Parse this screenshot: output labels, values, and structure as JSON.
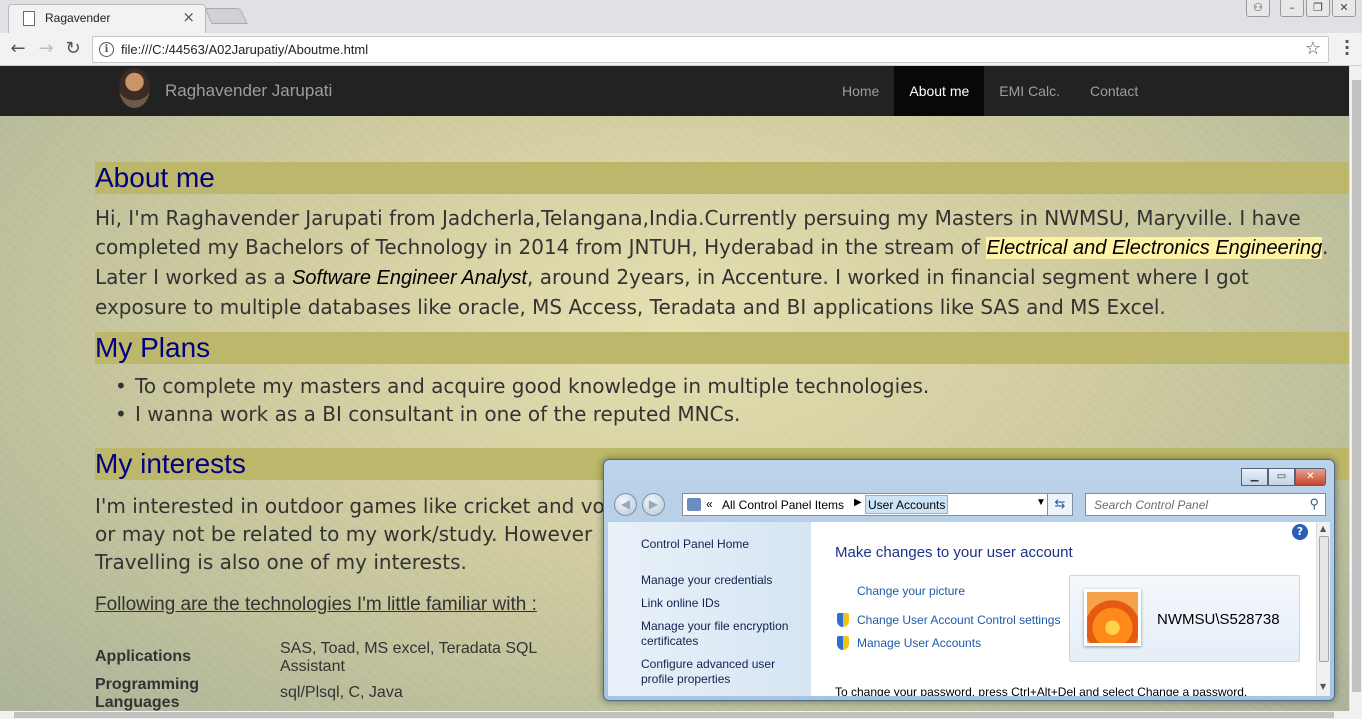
{
  "browser": {
    "tab_title": "Ragavender",
    "url": "file:///C:/44563/A02Jarupatiy/Aboutme.html"
  },
  "site": {
    "brand": "Raghavender Jarupati",
    "nav": [
      {
        "label": "Home",
        "active": false
      },
      {
        "label": "About me",
        "active": true
      },
      {
        "label": "EMI Calc.",
        "active": false
      },
      {
        "label": "Contact",
        "active": false
      }
    ]
  },
  "about": {
    "title": "About me",
    "p_part1": "Hi, I'm Raghavender Jarupati from Jadcherla,Telangana,India.Currently persuing my Masters in NWMSU, Maryville. I have completed my Bachelors of Technology in 2014 from JNTUH, Hyderabad in the stream of ",
    "p_em1": "Electrical and Electronics Engineering",
    "p_part2": ". Later I worked as a ",
    "p_em2": "Software Engineer Analyst",
    "p_part3": ", around 2years, in Accenture. I worked in financial segment where I got exposure to multiple databases like oracle, MS Access, Teradata and BI applications like SAS and MS Excel."
  },
  "plans": {
    "title": "My Plans",
    "items": [
      "To complete my masters and acquire good knowledge in multiple technologies.",
      "I wanna work as a BI consultant in one of the reputed MNCs."
    ]
  },
  "interests": {
    "title": "My interests",
    "p": "I'm interested in outdoor games like cricket and vo or may not be related to my work/study. However Travelling is also one of my interests."
  },
  "technologies": {
    "intro": "Following are the technologies I'm little familiar with :",
    "rows": [
      {
        "key": "Applications",
        "value": "SAS, Toad, MS excel, Teradata SQL Assistant"
      },
      {
        "key": "Programming Languages",
        "value": "sql/Plsql, C, Java"
      }
    ]
  },
  "control_panel": {
    "breadcrumb_root": "All Control Panel Items",
    "breadcrumb_current": "User Accounts",
    "search_placeholder": "Search Control Panel",
    "sidebar": [
      "Control Panel Home",
      "Manage your credentials",
      "Link online IDs",
      "Manage your file encryption certificates",
      "Configure advanced user profile properties"
    ],
    "heading": "Make changes to your user account",
    "links": [
      "Change your picture",
      "Change User Account Control settings",
      "Manage User Accounts"
    ],
    "username": "NWMSU\\S528738",
    "footer": "To change your password, press Ctrl+Alt+Del and select Change a password."
  }
}
